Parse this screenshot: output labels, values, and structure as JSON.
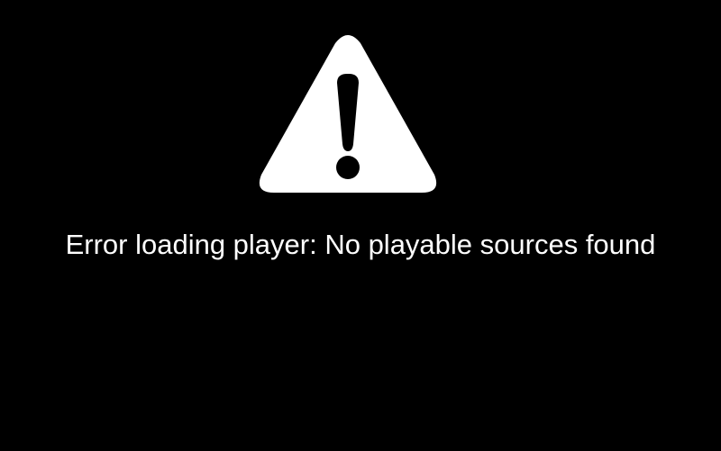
{
  "player": {
    "background_color": "#000000",
    "error_icon": "warning-triangle-icon",
    "icon_color": "#ffffff",
    "error_message": "Error loading player: No playable sources found"
  }
}
